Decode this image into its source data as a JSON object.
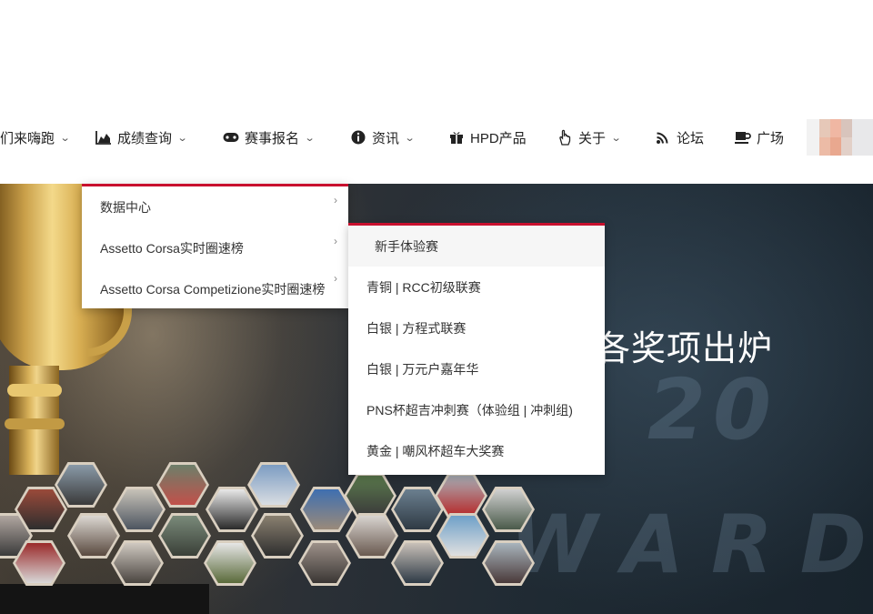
{
  "nav": {
    "items": [
      {
        "label": "们来嗨跑",
        "icon": "none",
        "has_dropdown": true
      },
      {
        "label": "成绩查询",
        "icon": "area-chart-icon",
        "has_dropdown": true
      },
      {
        "label": "赛事报名",
        "icon": "gamepad-icon",
        "has_dropdown": true
      },
      {
        "label": "资讯",
        "icon": "info-circle-icon",
        "has_dropdown": true
      },
      {
        "label": "HPD产品",
        "icon": "gift-icon",
        "has_dropdown": false
      },
      {
        "label": "关于",
        "icon": "hand-pointer-icon",
        "has_dropdown": true
      },
      {
        "label": "论坛",
        "icon": "wifi-signal-icon",
        "has_dropdown": false
      },
      {
        "label": "广场",
        "icon": "coffee-cup-icon",
        "has_dropdown": false
      }
    ],
    "chevron": "⌄"
  },
  "menu_level1": {
    "items": [
      {
        "label": "数据中心"
      },
      {
        "label": "Assetto Corsa实时圈速榜"
      },
      {
        "label": "Assetto Corsa Competizione实时圈速榜"
      }
    ],
    "arrow": "›"
  },
  "menu_level2": {
    "items": [
      {
        "label": "新手体验赛"
      },
      {
        "label": "青铜 | RCC初级联赛"
      },
      {
        "label": "白银 | 方程式联赛"
      },
      {
        "label": "白银 | 万元户嘉年华"
      },
      {
        "label": "PNS杯超吉冲刺赛（体验组 | 冲刺组)"
      },
      {
        "label": "黄金 | 嘲风杯超车大奖赛"
      }
    ]
  },
  "hero": {
    "title_visible": "各奖项出炉",
    "watermark_year": "20",
    "watermark_word": "WARD"
  },
  "colors": {
    "accent": "#c8102e",
    "nav_text": "#222222",
    "menu_bg": "#ffffff"
  }
}
